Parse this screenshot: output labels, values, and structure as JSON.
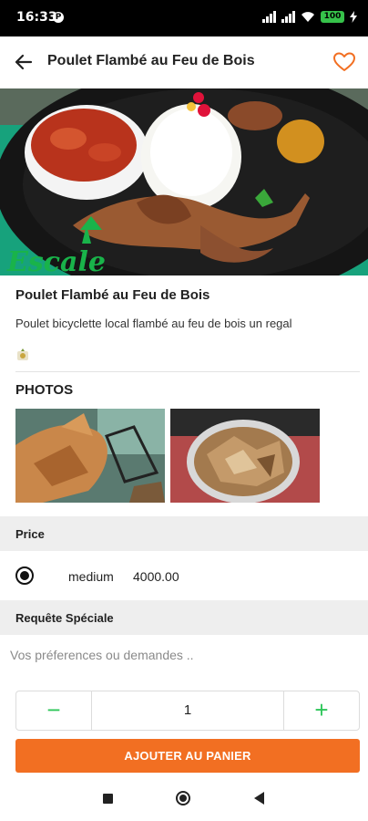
{
  "status_bar": {
    "time": "16:33",
    "battery": "100"
  },
  "app_bar": {
    "title": "Poulet Flambé au Feu de Bois"
  },
  "item": {
    "name": "Poulet Flambé au Feu de Bois",
    "description": "Poulet bicyclette local flambé au feu de bois un regal",
    "hero_logo_text": "Escale"
  },
  "photos": {
    "heading": "PHOTOS"
  },
  "price": {
    "heading": "Price",
    "options": [
      {
        "name": "medium",
        "value": "4000.00",
        "selected": true
      }
    ]
  },
  "special_request": {
    "heading": "Requête Spéciale",
    "placeholder": "Vos préferences ou demandes ..",
    "value": ""
  },
  "quantity": {
    "value": "1",
    "minus": "−",
    "plus": "+"
  },
  "add_to_cart": {
    "label": "AJOUTER AU PANIER"
  },
  "colors": {
    "accent": "#f26f22",
    "stepper_green": "#2ec65a",
    "heart": "#f26f22"
  },
  "icons": [
    "back-arrow-icon",
    "heart-icon",
    "veg-icon",
    "radio-selected-icon",
    "minus-icon",
    "plus-icon",
    "nav-recents-icon",
    "nav-home-icon",
    "nav-back-icon"
  ]
}
